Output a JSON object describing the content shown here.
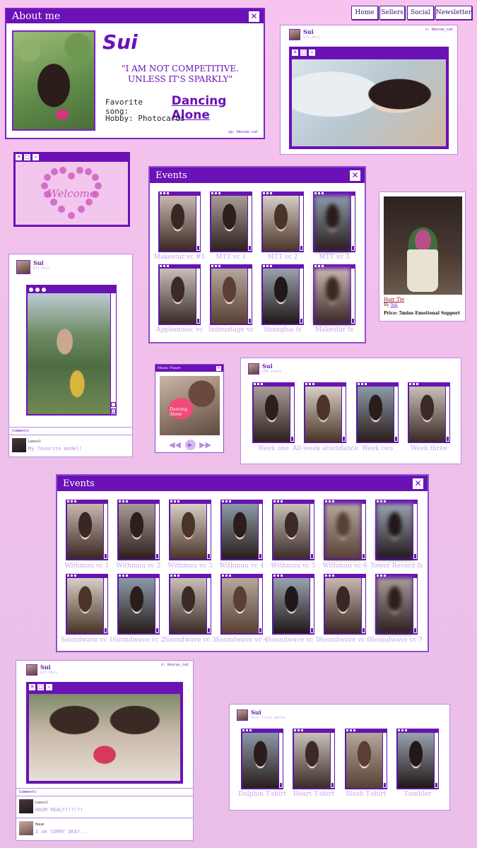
{
  "nav": {
    "home": "Home",
    "sellers": "Sellers",
    "social": "Social",
    "newsletter": "Newsletter"
  },
  "about": {
    "title": "About me",
    "name": "Sui",
    "quote": "\"I AM NOT COMPETITIVE. UNLESS IT'S SPARKLY\"",
    "song_label": "Favorite song:",
    "song": "Dancing Alone",
    "hobby": "Hobby: Photocards",
    "ig": "ig: kkuras.cat"
  },
  "post1": {
    "name": "Sui",
    "handle": "ktl.kkii",
    "tag": "x: kkuras_cat"
  },
  "welcome": "Welcome",
  "events1": {
    "title": "Events",
    "items": [
      "Makestar vc #1",
      "MTT vc 1",
      "MTT vc 2",
      "MTT vc 3",
      "Applemusic vc",
      "Indoustage vc",
      "Shanghai fs",
      "Makestar fs"
    ]
  },
  "shop": {
    "item": "Hair Tie",
    "by_label": "By",
    "by": "Sui",
    "price": "Price: 5mins Emotional Support"
  },
  "post2": {
    "name": "Sui",
    "handle": "ktl.kkii",
    "comments_label": "Comments",
    "comment_user": "Leesol",
    "comment_text": "My favorite model!"
  },
  "music": {
    "title": "Music Player",
    "cup_text": "Dancing Alone"
  },
  "post3": {
    "name": "Sui",
    "handle": "VHS event",
    "items": [
      "Week one",
      "All-week attendance",
      "Week two",
      "Week three"
    ]
  },
  "events2": {
    "title": "Events",
    "row1": [
      "Withmuu vc 1",
      "Withmuu vc 2",
      "Withmuu vc 3",
      "Withmuu vc 4",
      "Withmuu vc 5",
      "Withmuu vc 6",
      "Tower Record fs"
    ],
    "row2": [
      "Soundwave vc 1",
      "Soundwave vc 2",
      "Soundwave vc 3",
      "Soundwave vc 4",
      "Soundwave vc 5",
      "Soundwave vc 6",
      "Soundwave vc 7"
    ]
  },
  "post4": {
    "name": "Sui",
    "handle": "ktl.kkii",
    "tag": "x: kkuras_cat",
    "comments_label": "Comments",
    "c1_user": "Leesol",
    "c1_text": "HAUM REALY?!?!?!",
    "c2_user": "Haum",
    "c2_text": "I am SORRY OKAY..."
  },
  "post5": {
    "name": "Sui",
    "handle": "Solo truck merch",
    "items": [
      "Dolphin T-shirt",
      "Heart T-shirt",
      "Slush T-shirt",
      "Tumbler"
    ]
  },
  "colors": {
    "accent": "#6a12b6",
    "caption": "#c8a4ec",
    "background": "#f3c3ec"
  }
}
